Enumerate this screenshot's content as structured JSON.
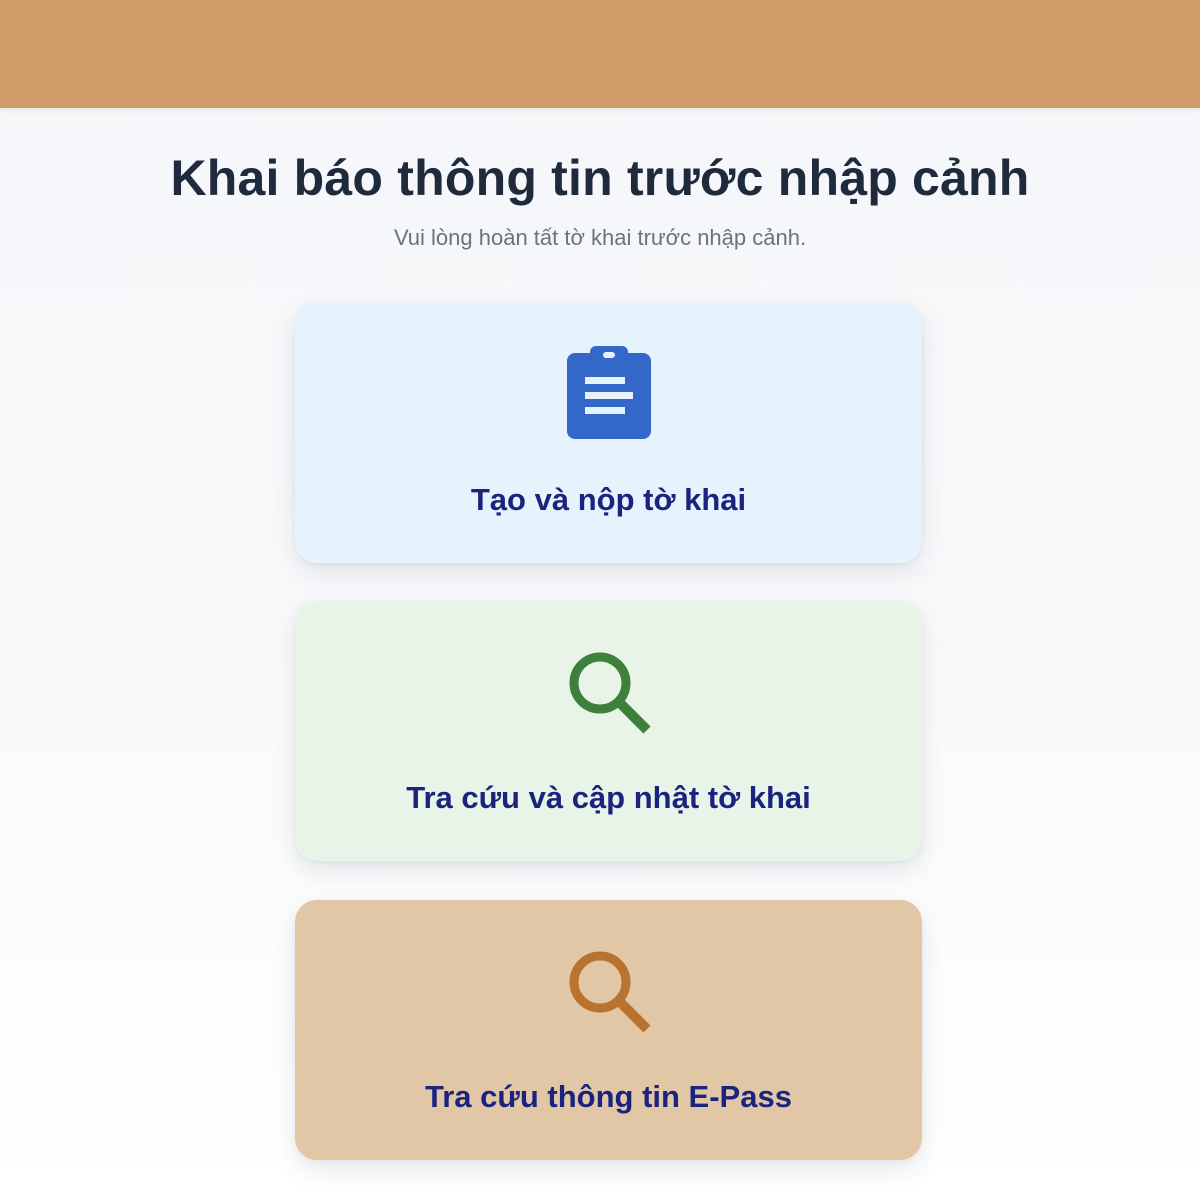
{
  "page": {
    "title": "Khai báo thông tin trước nhập cảnh",
    "subtitle": "Vui lòng hoàn tất tờ khai trước nhập cảnh."
  },
  "cards": [
    {
      "label": "Tạo và nộp tờ khai",
      "icon": "clipboard-icon",
      "background": "#e6f2fc",
      "icon_color": "#3367c8"
    },
    {
      "label": "Tra cứu và cập nhật tờ khai",
      "icon": "search-icon",
      "background": "#e9f4e8",
      "icon_color": "#3f7f3c"
    },
    {
      "label": "Tra cứu thông tin E-Pass",
      "icon": "search-icon",
      "background": "#e2c7a6",
      "icon_color": "#b9732e"
    }
  ],
  "colors": {
    "header_bar": "#cf9d69",
    "title_text": "#1f2a3d",
    "subtitle_text": "#6b7280",
    "card_label_text": "#1a237e"
  }
}
